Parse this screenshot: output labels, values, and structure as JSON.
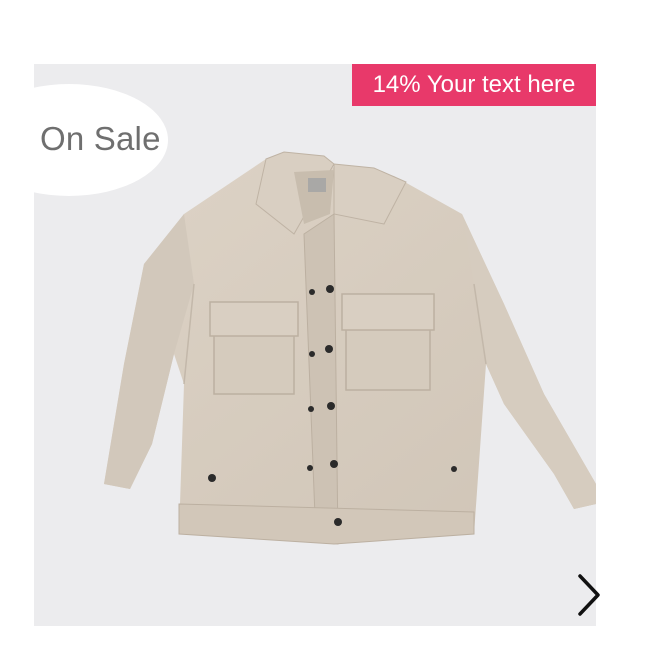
{
  "badges": {
    "sale_label": "On Sale",
    "discount_label": "14% Your text here",
    "discount_color": "#e8396a"
  },
  "product": {
    "image_subject": "beige button-up shirt jacket",
    "image_background": "#ececee"
  },
  "carousel": {
    "next_icon": "chevron-right-icon"
  }
}
